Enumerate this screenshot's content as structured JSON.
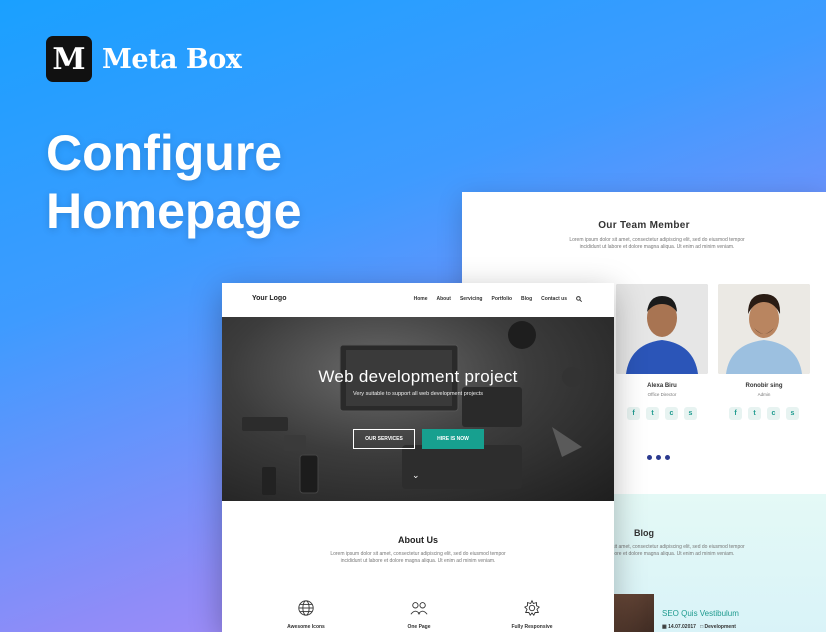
{
  "brand": {
    "mark": "M",
    "name": "Meta Box"
  },
  "headline": {
    "line1": "Configure",
    "line2": "Homepage"
  },
  "team": {
    "title": "Our Team Member",
    "description": "Lorem ipsum dolor sit amet, consectetur adipiscing elit, sed do eiusmod tempor incididunt ut labore et dolore magna aliqua. Ut enim ad minim veniam.",
    "members": [
      {
        "name": "Alexa Biru",
        "role": "Office Director"
      },
      {
        "name": "Ronobir sing",
        "role": "Admin"
      }
    ],
    "social_icons": [
      "f",
      "t",
      "c",
      "s"
    ]
  },
  "blog": {
    "title": "Blog",
    "description": "Lorem ipsum dolor sit amet, consectetur adipiscing elit, sed do eiusmod tempor incididunt ut labore et dolore magna aliqua. Ut enim ad minim veniam.",
    "post_title": "SEO Quis Vestibulum",
    "post_date": "14.07.02017",
    "post_category": "Development"
  },
  "homepage": {
    "logo": "Your Logo",
    "menu": [
      "Home",
      "About",
      "Servicing",
      "Portfolio",
      "Blog",
      "Contact us"
    ],
    "hero_title": "Web development project",
    "hero_subtitle": "Very suitable to support all web development projects",
    "btn_services": "OUR SERVICES",
    "btn_hire": "HIRE IS NOW",
    "about_title": "About Us",
    "about_desc": "Lorem ipsum dolor sit amet, consectetur adipiscing elit, sed do eiusmod tempor incididunt ut labore et dolore magna aliqua. Ut enim ad minim veniam.",
    "features": [
      "Awesome Icons",
      "One Page",
      "Fully Responsive"
    ]
  },
  "colors": {
    "accent": "#17a08f",
    "brand_bg": "#111111"
  }
}
